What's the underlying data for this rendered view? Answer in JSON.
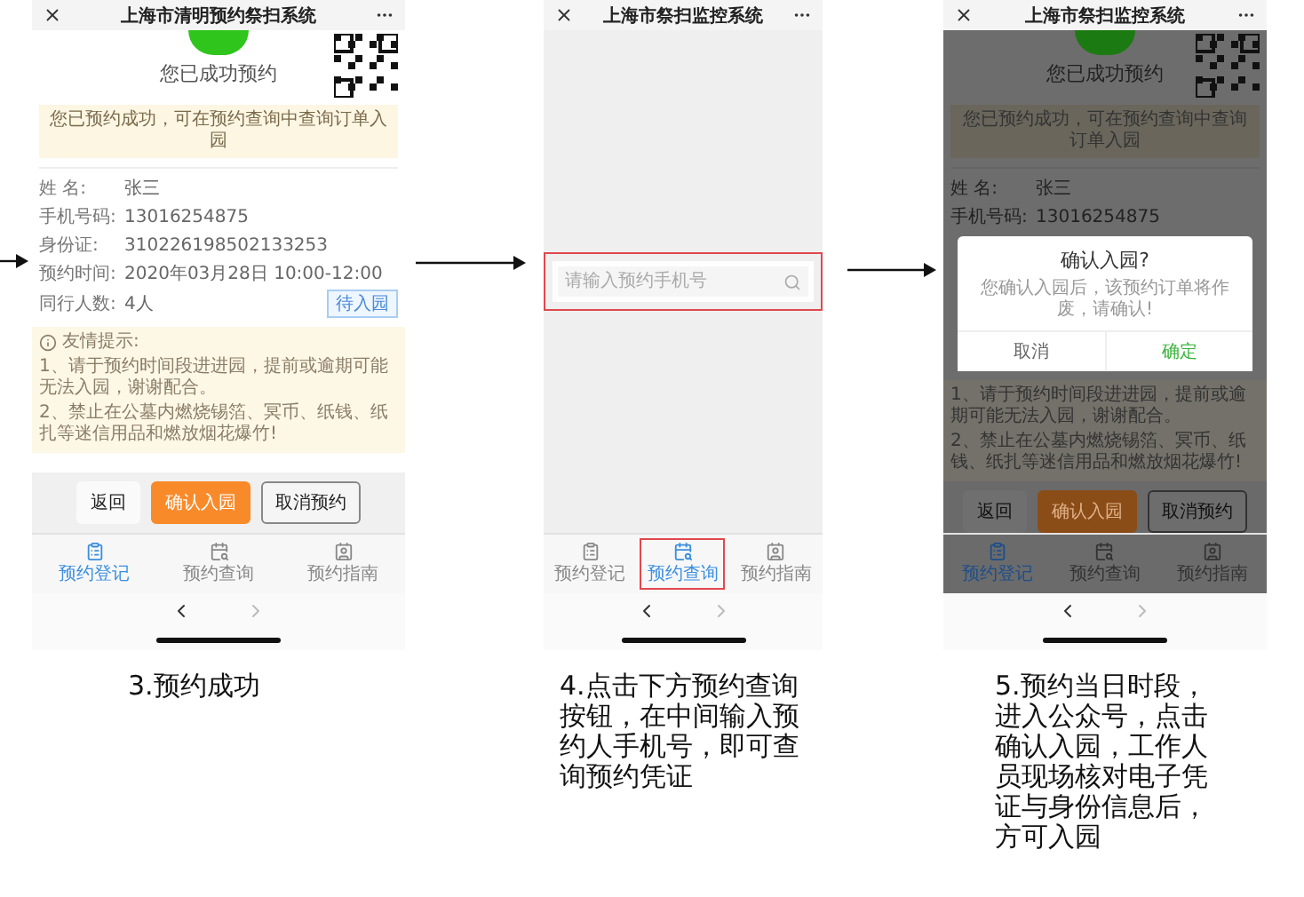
{
  "panels": [
    {
      "kind": "detail",
      "dimmed": false,
      "title": "上海市清明预约祭扫系统",
      "heading": "您已成功预约",
      "notice": "您已预约成功，可在预约查询中查询订单入园",
      "fields": [
        {
          "label": "姓 名:",
          "value": "张三"
        },
        {
          "label": "手机号码:",
          "value": "13016254875"
        },
        {
          "label": "身份证:",
          "value": "310226198502133253"
        },
        {
          "label": "预约时间:",
          "value": "2020年03月28日 10:00-12:00"
        },
        {
          "label": "同行人数:",
          "value": "4人"
        }
      ],
      "status_tag": "待入园",
      "tips": {
        "title": "友情提示:",
        "items": [
          "1、请于预约时间段进进园，提前或逾期可能无法入园，谢谢配合。",
          "2、禁止在公墓内燃烧锡箔、冥币、纸钱、纸扎等迷信用品和燃放烟花爆竹!"
        ]
      },
      "buttons": [
        {
          "label": "返回",
          "kind": "plain"
        },
        {
          "label": "确认入园",
          "kind": "primary"
        },
        {
          "label": "取消预约",
          "kind": "outline"
        }
      ],
      "tabs": [
        {
          "label": "预约登记",
          "selected": true,
          "highlighted": false
        },
        {
          "label": "预约查询",
          "selected": false,
          "highlighted": false
        },
        {
          "label": "预约指南",
          "selected": false,
          "highlighted": false
        }
      ],
      "caption": "3.预约成功"
    },
    {
      "kind": "search",
      "dimmed": false,
      "title": "上海市祭扫监控系统",
      "search": {
        "placeholder": "请输入预约手机号",
        "highlighted": true
      },
      "tabs": [
        {
          "label": "预约登记",
          "selected": false,
          "highlighted": false
        },
        {
          "label": "预约查询",
          "selected": true,
          "highlighted": true
        },
        {
          "label": "预约指南",
          "selected": false,
          "highlighted": false
        }
      ],
      "caption": "4.点击下方预约查询按钮，在中间输入预约人手机号，即可查询预约凭证"
    },
    {
      "kind": "detail",
      "dimmed": true,
      "title": "上海市祭扫监控系统",
      "heading": "您已成功预约",
      "notice": "您已预约成功，可在预约查询中查询订单入园",
      "fields": [
        {
          "label": "姓 名:",
          "value": "张三"
        },
        {
          "label": "手机号码:",
          "value": "13016254875"
        }
      ],
      "dialog": {
        "title": "确认入园?",
        "message": "您确认入园后，该预约订单将作废，请确认!",
        "buttons": [
          {
            "label": "取消",
            "kind": "cancel"
          },
          {
            "label": "确定",
            "kind": "confirm"
          }
        ]
      },
      "tips": {
        "items": [
          "1、请于预约时间段进进园，提前或逾期可能无法入园，谢谢配合。",
          "2、禁止在公墓内燃烧锡箔、冥币、纸钱、纸扎等迷信用品和燃放烟花爆竹!"
        ]
      },
      "buttons": [
        {
          "label": "返回",
          "kind": "plain"
        },
        {
          "label": "确认入园",
          "kind": "primary"
        },
        {
          "label": "取消预约",
          "kind": "outline"
        }
      ],
      "tabs": [
        {
          "label": "预约登记",
          "selected": true,
          "highlighted": false
        },
        {
          "label": "预约查询",
          "selected": false,
          "highlighted": false
        },
        {
          "label": "预约指南",
          "selected": false,
          "highlighted": false
        }
      ],
      "caption": "5.预约当日时段，进入公众号，点击确认入园，工作人员现场核对电子凭证与身份信息后，方可入园"
    }
  ]
}
